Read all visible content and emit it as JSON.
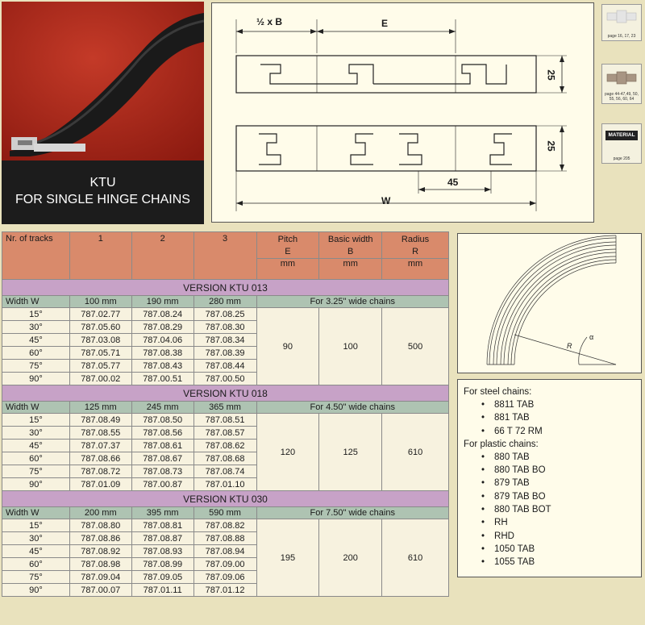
{
  "product": {
    "title": "KTU",
    "subtitle": "FOR SINGLE HINGE CHAINS"
  },
  "drawing": {
    "half_b": "½ x B",
    "e": "E",
    "dim_25_top": "25",
    "dim_25_bottom": "25",
    "dim_45": "45",
    "w": "W"
  },
  "side_icons": [
    {
      "name": "chain-icon",
      "text": "page 16, 17, 23"
    },
    {
      "name": "plastic-chain-icon",
      "text": "page 44-47,49, 50, 55, 56, 60, 64"
    },
    {
      "name": "material-icon",
      "label": "MATERIAL",
      "text": "page 205"
    }
  ],
  "table": {
    "header": {
      "tracks_label": "Nr. of tracks",
      "cols": [
        "1",
        "2",
        "3"
      ],
      "pitch": "Pitch",
      "pitch_sym": "E",
      "pitch_unit": "mm",
      "basic": "Basic width",
      "basic_sym": "B",
      "basic_unit": "mm",
      "radius": "Radius",
      "radius_sym": "R",
      "radius_unit": "mm"
    },
    "versions": [
      {
        "title": "VERSION KTU 013",
        "width_label": "Width W",
        "widths": [
          "100 mm",
          "190 mm",
          "280 mm"
        ],
        "for_text": "For 3.25\" wide chains",
        "pitch": "90",
        "basic": "100",
        "radius": "500",
        "rows": [
          {
            "angle": "15°",
            "c1": "787.02.77",
            "c2": "787.08.24",
            "c3": "787.08.25"
          },
          {
            "angle": "30°",
            "c1": "787.05.60",
            "c2": "787.08.29",
            "c3": "787.08.30"
          },
          {
            "angle": "45°",
            "c1": "787.03.08",
            "c2": "787.04.06",
            "c3": "787.08.34"
          },
          {
            "angle": "60°",
            "c1": "787.05.71",
            "c2": "787.08.38",
            "c3": "787.08.39"
          },
          {
            "angle": "75°",
            "c1": "787.05.77",
            "c2": "787.08.43",
            "c3": "787.08.44"
          },
          {
            "angle": "90°",
            "c1": "787.00.02",
            "c2": "787.00.51",
            "c3": "787.00.50"
          }
        ]
      },
      {
        "title": "VERSION KTU 018",
        "width_label": "Width W",
        "widths": [
          "125 mm",
          "245 mm",
          "365 mm"
        ],
        "for_text": "For 4.50\" wide chains",
        "pitch": "120",
        "basic": "125",
        "radius": "610",
        "rows": [
          {
            "angle": "15°",
            "c1": "787.08.49",
            "c2": "787.08.50",
            "c3": "787.08.51"
          },
          {
            "angle": "30°",
            "c1": "787.08.55",
            "c2": "787.08.56",
            "c3": "787.08.57"
          },
          {
            "angle": "45°",
            "c1": "787.07.37",
            "c2": "787.08.61",
            "c3": "787.08.62"
          },
          {
            "angle": "60°",
            "c1": "787.08.66",
            "c2": "787.08.67",
            "c3": "787.08.68"
          },
          {
            "angle": "75°",
            "c1": "787.08.72",
            "c2": "787.08.73",
            "c3": "787.08.74"
          },
          {
            "angle": "90°",
            "c1": "787.01.09",
            "c2": "787.00.87",
            "c3": "787.01.10"
          }
        ]
      },
      {
        "title": "VERSION KTU 030",
        "width_label": "Width W",
        "widths": [
          "200 mm",
          "395 mm",
          "590 mm"
        ],
        "for_text": "For 7.50\" wide chains",
        "pitch": "195",
        "basic": "200",
        "radius": "610",
        "rows": [
          {
            "angle": "15°",
            "c1": "787.08.80",
            "c2": "787.08.81",
            "c3": "787.08.82"
          },
          {
            "angle": "30°",
            "c1": "787.08.86",
            "c2": "787.08.87",
            "c3": "787.08.88"
          },
          {
            "angle": "45°",
            "c1": "787.08.92",
            "c2": "787.08.93",
            "c3": "787.08.94"
          },
          {
            "angle": "60°",
            "c1": "787.08.98",
            "c2": "787.08.99",
            "c3": "787.09.00"
          },
          {
            "angle": "75°",
            "c1": "787.09.04",
            "c2": "787.09.05",
            "c3": "787.09.06"
          },
          {
            "angle": "90°",
            "c1": "787.00.07",
            "c2": "787.01.11",
            "c3": "787.01.12"
          }
        ]
      }
    ]
  },
  "quadrant": {
    "r_label": "R",
    "angle_label": "α"
  },
  "chains": {
    "steel_heading": "For steel chains:",
    "steel": [
      "8811 TAB",
      "881 TAB",
      "66 T 72 RM"
    ],
    "plastic_heading": "For plastic chains:",
    "plastic": [
      "880 TAB",
      "880 TAB BO",
      "879 TAB",
      "879 TAB BO",
      "880 TAB BOT",
      "RH",
      "RHD",
      "1050 TAB",
      "1055 TAB"
    ],
    "bullet": "•"
  }
}
